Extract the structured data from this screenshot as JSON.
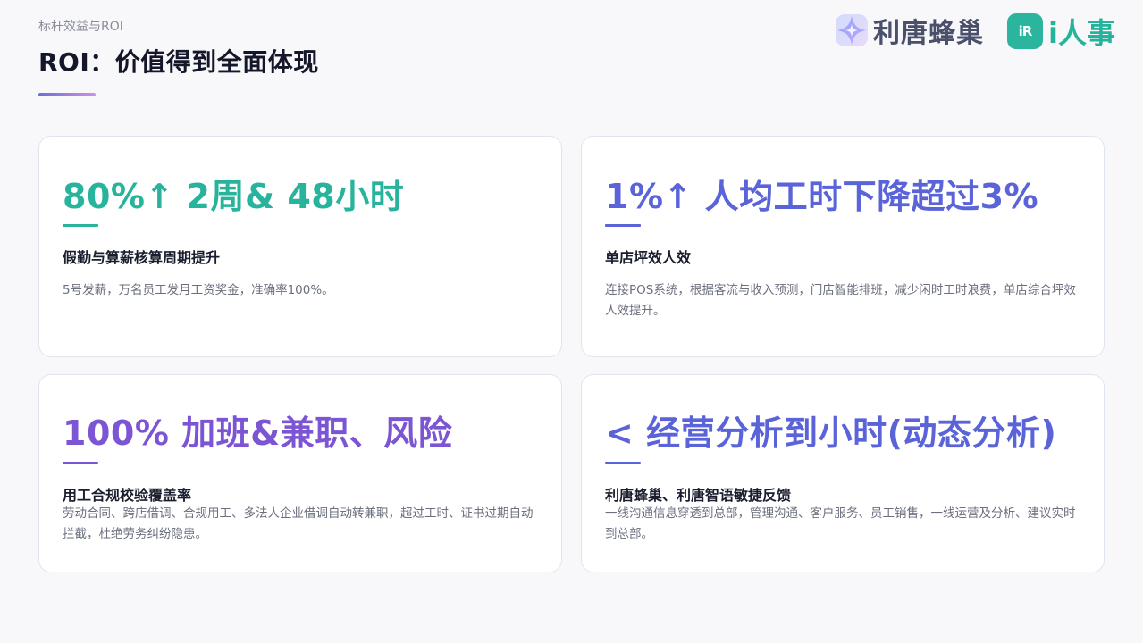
{
  "header": {
    "breadcrumb": "标杆效益与ROI",
    "title": "ROI：价值得到全面体现"
  },
  "logos": {
    "litang": {
      "icon": "sparkle-logo-icon",
      "text": "利唐蜂巢"
    },
    "irenshi": {
      "icon": "ir-logo-icon",
      "mark_text": "iR",
      "text": "i人事"
    }
  },
  "colors": {
    "teal": "#28b39d",
    "blue": "#5a63d8",
    "purple": "#7c55d4",
    "underline_gradient": [
      "#6b6fd8",
      "#d38ee6"
    ]
  },
  "cards": [
    {
      "headline": "80%↑ 2周& 48小时",
      "subtitle": "假勤与算薪核算周期提升",
      "description": "5号发薪，万名员工发月工资奖金，准确率100%。"
    },
    {
      "headline": "1%↑ 人均工时下降超过3%",
      "subtitle": "单店坪效人效",
      "description": "连接POS系统，根据客流与收入预测，门店智能排班，减少闲时工时浪费，单店综合坪效人效提升。"
    },
    {
      "headline": "100% 加班&兼职、风险",
      "subtitle": "用工合规校验覆盖率",
      "description": "劳动合同、跨店借调、合规用工、多法人企业借调自动转兼职，超过工时、证书过期自动拦截，杜绝劳务纠纷隐患。"
    },
    {
      "headline": "< 经营分析到小时(动态分析)",
      "subtitle": "利唐蜂巢、利唐智语敏捷反馈",
      "description": "一线沟通信息穿透到总部，管理沟通、客户服务、员工销售，一线运营及分析、建议实时到总部。"
    }
  ]
}
